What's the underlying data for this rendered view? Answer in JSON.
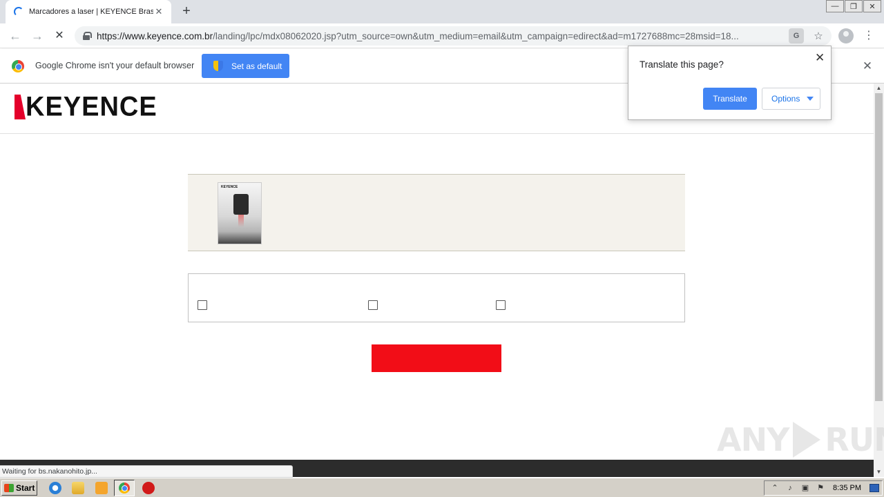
{
  "browser": {
    "tab_title": "Marcadores a laser | KEYENCE Brasil",
    "tab_close": "✕",
    "new_tab": "+",
    "url_host": "https://www.keyence.com.br",
    "url_path": "/landing/lpc/mdx08062020.jsp?utm_source=own&utm_medium=email&utm_campaign=edirect&ad=m1727688mc=28msid=18...",
    "back": "←",
    "forward": "→",
    "stop": "✕",
    "translate_icon": "G",
    "star": "☆",
    "menu": "⋮",
    "window": {
      "minimize": "—",
      "restore": "❐",
      "close": "✕"
    }
  },
  "infobar": {
    "message": "Google Chrome isn't your default browser",
    "button": "Set as default",
    "close": "✕"
  },
  "translate_popup": {
    "title": "Translate this page?",
    "translate_button": "Translate",
    "options_button": "Options",
    "close": "✕"
  },
  "site": {
    "logo_text": "KEYENCE",
    "catalog_logo": "KEYENCE",
    "checkboxes": [
      false,
      false,
      false
    ],
    "submit_color": "#f20d17"
  },
  "status": {
    "text": "Waiting for bs.nakanohito.jp..."
  },
  "watermark": {
    "left": "ANY",
    "right": "RUN"
  },
  "taskbar": {
    "start": "Start",
    "clock": "8:35 PM"
  },
  "colors": {
    "accent_blue": "#4285f4",
    "brand_red": "#e4002b",
    "submit_red": "#f20d17"
  }
}
